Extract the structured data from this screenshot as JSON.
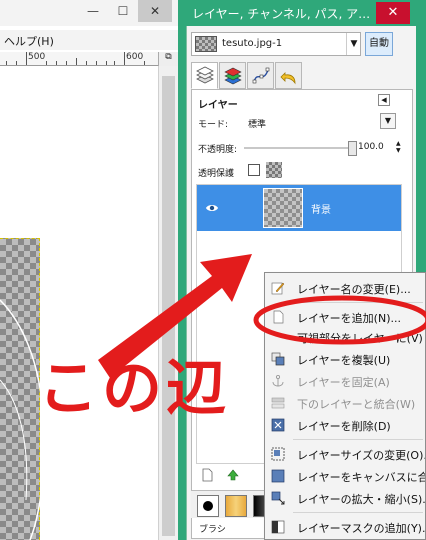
{
  "left_window": {
    "min_glyph": "—",
    "max_glyph": "☐",
    "close_glyph": "✕",
    "menu_help": "ヘルプ(H)",
    "ruler_labels": [
      "500",
      "600"
    ],
    "ruler_corner_glyph": "⧉"
  },
  "dock": {
    "title": "レイヤー, チャンネル, パス, ア…",
    "close_glyph": "✕",
    "image_name": "tesuto.jpg-1",
    "auto_button": "自動",
    "panel": {
      "title": "レイヤー",
      "mode_label": "モード:",
      "mode_value": "標準",
      "opacity_label": "不透明度:",
      "opacity_value": "100.0",
      "opacity_fraction": 1.0,
      "lock_label": "透明保護"
    },
    "layer": {
      "name": "背景",
      "visible": true
    },
    "brush_label": "ブラシ"
  },
  "context_menu": {
    "items": [
      {
        "label": "レイヤー名の変更(E)...",
        "icon": "edit-icon",
        "disabled": false
      },
      {
        "label": "レイヤーを追加(N)...",
        "icon": "new-layer-icon",
        "disabled": false
      },
      {
        "label": "可視部分をレイヤーに(V)",
        "icon": "",
        "disabled": false
      },
      {
        "label": "レイヤーを複製(U)",
        "icon": "duplicate-icon",
        "disabled": false
      },
      {
        "label": "レイヤーを固定(A)",
        "icon": "anchor-icon",
        "disabled": true
      },
      {
        "label": "下のレイヤーと統合(W)",
        "icon": "merge-icon",
        "disabled": true
      },
      {
        "label": "レイヤーを削除(D)",
        "icon": "delete-icon",
        "disabled": false
      },
      {
        "label": "レイヤーサイズの変更(O)...",
        "icon": "resize-icon",
        "disabled": false
      },
      {
        "label": "レイヤーをキャンバスに合わせる",
        "icon": "fit-canvas-icon",
        "disabled": false
      },
      {
        "label": "レイヤーの拡大・縮小(S)...",
        "icon": "scale-icon",
        "disabled": false
      },
      {
        "label": "レイヤーマスクの追加(Y)...",
        "icon": "add-mask-icon",
        "disabled": false
      }
    ]
  },
  "annotation": {
    "text": "この辺",
    "color": "#e31c1c"
  },
  "colors": {
    "dock_green": "#2fa87a",
    "selection_blue": "#3e8fe6",
    "close_red": "#c8102e"
  }
}
